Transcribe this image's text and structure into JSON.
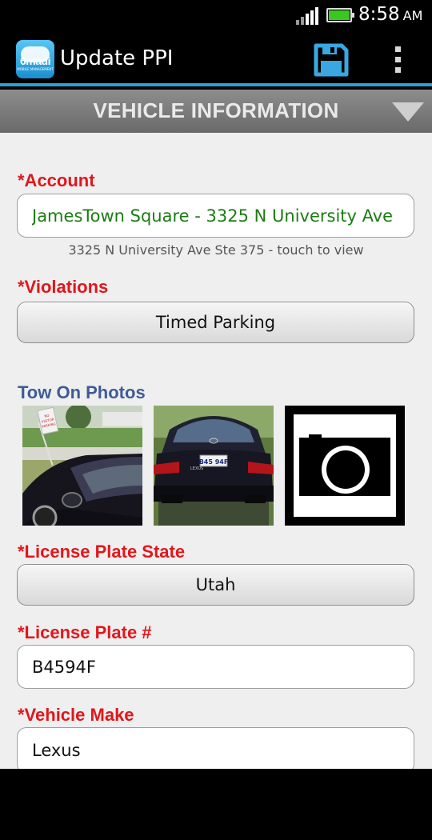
{
  "status_bar": {
    "time": "8:58",
    "ampm": "AM"
  },
  "action_bar": {
    "title": "Update PPI",
    "logo_text": "6madi",
    "logo_subtext": "MOBILE MANAGEMENT"
  },
  "section": {
    "title": "VEHICLE INFORMATION"
  },
  "form": {
    "account_label": "*Account",
    "account_value": "JamesTown Square - 3325 N University Ave",
    "account_hint": "3325 N University Ave Ste 375 - touch to view",
    "violations_label": "*Violations",
    "violations_value": "Timed Parking",
    "photos_label": "Tow On Photos",
    "plate_state_label": "*License Plate State",
    "plate_state_value": "Utah",
    "plate_number_label": "*License Plate #",
    "plate_number_value": "B4594F",
    "make_label": "*Vehicle Make",
    "make_value": "Lexus"
  },
  "photo_content": {
    "sign_text": "NO VISITOR PARKING",
    "plate_text": "B45 94F",
    "car_badge": "LEXUS"
  },
  "colors": {
    "accent": "#2f9fd6",
    "required_label": "#e2161c",
    "section_label": "#3f5b96",
    "account_text": "#1a7d12"
  },
  "icons": [
    "save-icon",
    "overflow-menu-icon",
    "dropdown-triangle-icon",
    "camera-icon"
  ]
}
